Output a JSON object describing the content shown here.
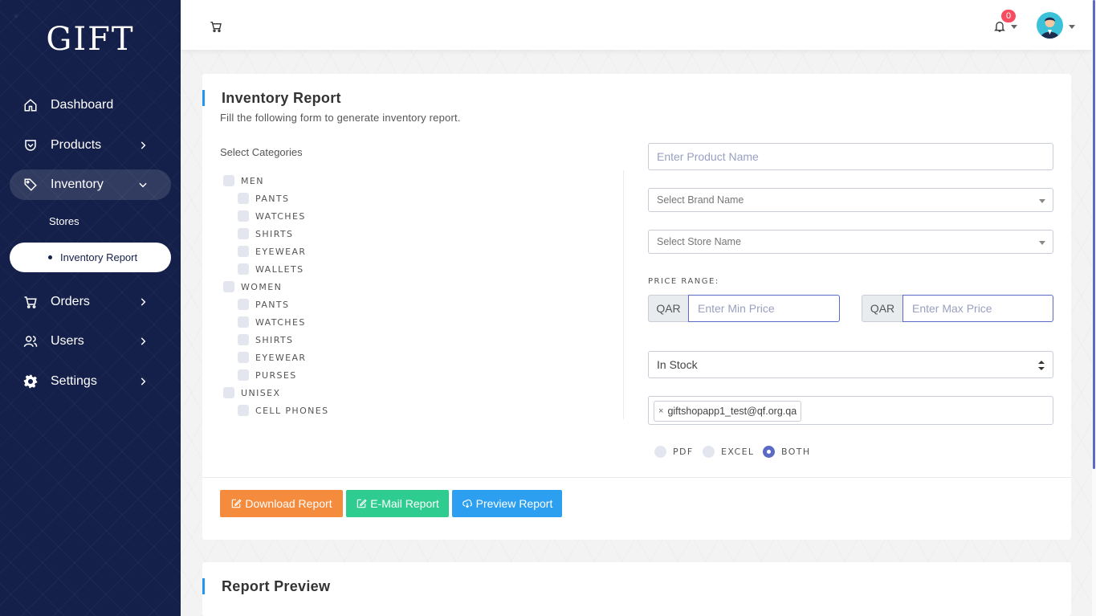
{
  "sidebar": {
    "logo": "GIFT",
    "items": [
      {
        "label": "Dashboard",
        "icon": "home-icon"
      },
      {
        "label": "Products",
        "icon": "shield-icon"
      },
      {
        "label": "Inventory",
        "icon": "tag-icon"
      },
      {
        "label": "Orders",
        "icon": "cart-icon"
      },
      {
        "label": "Users",
        "icon": "users-icon"
      },
      {
        "label": "Settings",
        "icon": "gear-icon"
      }
    ],
    "inventory_sub": {
      "stores": "Stores",
      "report": "Inventory Report"
    }
  },
  "topbar": {
    "notification_count": "0"
  },
  "form": {
    "title": "Inventory Report",
    "subtitle": "Fill the following form to generate inventory report.",
    "categories_label": "Select Categories",
    "categories": {
      "men": "MEN",
      "men_items": [
        "PANTS",
        "WATCHES",
        "SHIRTS",
        "EYEWEAR",
        "WALLETS"
      ],
      "women": "WOMEN",
      "women_items": [
        "PANTS",
        "WATCHES",
        "SHIRTS",
        "EYEWEAR",
        "PURSES"
      ],
      "unisex": "UNISEX",
      "unisex_items": [
        "CELL PHONES"
      ]
    },
    "product_placeholder": "Enter Product Name",
    "brand_placeholder": "Select Brand Name",
    "store_placeholder": "Select Store Name",
    "price_range_label": "PRICE RANGE:",
    "currency": "QAR",
    "min_placeholder": "Enter Min Price",
    "max_placeholder": "Enter Max Price",
    "stock_value": "In Stock",
    "email_tag": "giftshopapp1_test@qf.org.qa",
    "email_tag_remove": "×",
    "formats": {
      "pdf": "PDF",
      "excel": "EXCEL",
      "both": "BOTH",
      "selected": "BOTH"
    },
    "buttons": {
      "download": "Download Report",
      "email": "E-Mail Report",
      "preview": "Preview Report"
    }
  },
  "preview": {
    "title": "Report Preview"
  },
  "colors": {
    "sidebar": "#14204a",
    "accent": "#5b6ac4",
    "download": "#f58b3c",
    "email": "#2ecc8f",
    "preview": "#2c9ff0",
    "badge": "#f64e60"
  }
}
